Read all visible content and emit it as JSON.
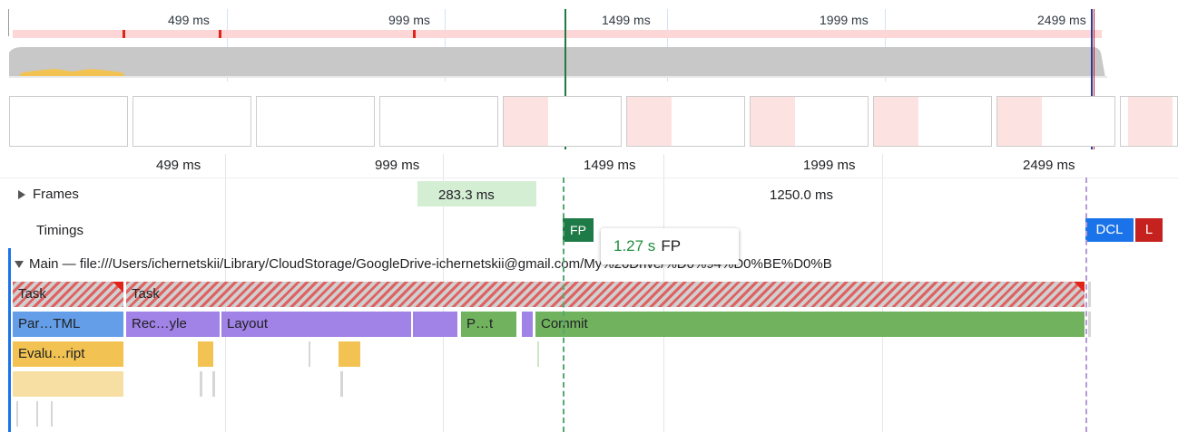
{
  "overview": {
    "ticks": [
      "499 ms",
      "999 ms",
      "1499 ms",
      "1999 ms",
      "2499 ms"
    ]
  },
  "ruler": {
    "ticks": [
      "499 ms",
      "999 ms",
      "1499 ms",
      "1999 ms",
      "2499 ms"
    ]
  },
  "frames": {
    "label": "Frames",
    "durations": [
      "283.3 ms",
      "1250.0 ms"
    ]
  },
  "timings": {
    "label": "Timings",
    "markers": [
      {
        "label": "FP",
        "color": "#1e7b47"
      },
      {
        "label": "DCL",
        "color": "#1a73e8"
      },
      {
        "label": "L",
        "color": "#c5221f"
      }
    ],
    "tooltip": {
      "time": "1.27 s",
      "name": "FP"
    }
  },
  "main": {
    "title": "Main — file:///Users/ichernetskii/Library/CloudStorage/GoogleDrive-ichernetskii@gmail.com/My%20Drive/%D0%94%D0%BE%D0%B",
    "tasks": [
      "Task",
      "Task"
    ],
    "row2": [
      "Par…TML",
      "Rec…yle",
      "Layout",
      "P…t",
      "Commit"
    ],
    "row3": [
      "Evalu…ript"
    ]
  },
  "colors": {
    "task": "#d0d0d0",
    "parse_html": "#649ee8",
    "recalc_style": "#a182e6",
    "layout": "#a182e6",
    "paint": "#71b25f",
    "commit": "#71b25f",
    "scripting": "#f2c352",
    "long_task": "#e0241a"
  }
}
